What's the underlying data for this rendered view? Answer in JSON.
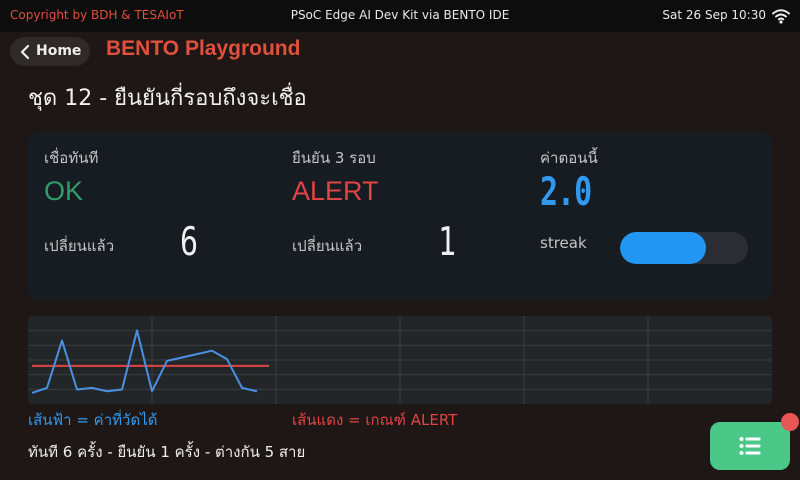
{
  "topbar": {
    "copyright": "Copyright by BDH & TESAIoT",
    "center_title": "PSoC Edge AI Dev Kit via BENTO IDE",
    "datetime": "Sat 26 Sep 10:30",
    "wifi_icon": "wifi-icon"
  },
  "header": {
    "home_label": "Home",
    "app_title": "BENTO Playground"
  },
  "set_title": "ชุด 12 - ยืนยันกี่รอบถึงจะเชื่อ",
  "panel": {
    "col1": {
      "label": "เชื่อทันที",
      "state": "OK",
      "changed_label": "เปลี่ยนแล้ว",
      "changed_value": "6"
    },
    "col2": {
      "label": "ยืนยัน 3 รอบ",
      "state": "ALERT",
      "changed_label": "เปลี่ยนแล้ว",
      "changed_value": "1"
    },
    "col3": {
      "label": "ค่าตอนนี้",
      "value": "2.0",
      "streak_label": "streak",
      "streak_fill_fraction": 0.67
    }
  },
  "chart_data": {
    "type": "line",
    "series": [
      {
        "values": [
          0.3,
          0.6,
          3.4,
          0.5,
          0.6,
          0.4,
          0.5,
          4.0,
          0.4,
          2.2,
          2.4,
          2.6,
          2.8,
          2.3,
          0.6,
          0.4
        ]
      }
    ],
    "threshold": 1.9,
    "ylim": [
      0,
      4.5
    ],
    "x_count": 30,
    "colors": {
      "series": "#4a90e2",
      "threshold": "#e04444",
      "grid": "#3a3e42"
    },
    "grid": true
  },
  "legend": {
    "blue": "เส้นฟ้า = ค่าที่วัดได้",
    "red": "เส้นแดง = เกณฑ์ ALERT"
  },
  "summary": "ทันที 6 ครั้ง - ยืนยัน 1 ครั้ง - ต่างกัน 5 สาย",
  "fab": {
    "icon": "list-icon"
  }
}
